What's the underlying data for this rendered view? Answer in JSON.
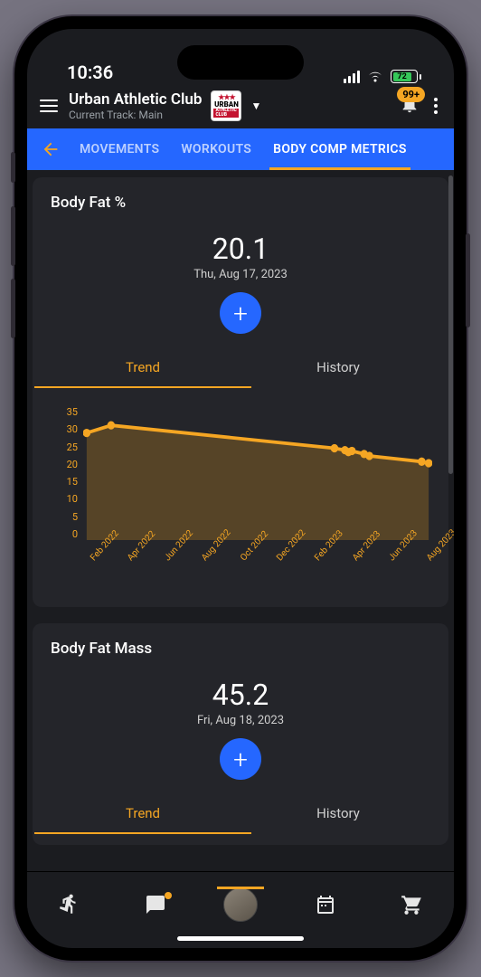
{
  "status": {
    "time": "10:36",
    "battery_pct": "72"
  },
  "header": {
    "club_name": "Urban Athletic Club",
    "subtitle": "Current Track: Main",
    "badge": "99+"
  },
  "segments": {
    "back_icon": "back",
    "items": [
      {
        "label": "MOVEMENTS",
        "active": false
      },
      {
        "label": "WORKOUTS",
        "active": false
      },
      {
        "label": "BODY COMP METRICS",
        "active": true
      }
    ]
  },
  "cards": [
    {
      "title": "Body Fat %",
      "value": "20.1",
      "date": "Thu, Aug 17, 2023",
      "tabs": {
        "trend": "Trend",
        "history": "History",
        "active": "trend"
      }
    },
    {
      "title": "Body Fat Mass",
      "value": "45.2",
      "date": "Fri, Aug 18, 2023",
      "tabs": {
        "trend": "Trend",
        "history": "History",
        "active": "trend"
      }
    }
  ],
  "chart_data": {
    "type": "area",
    "title": "Body Fat % Trend",
    "xlabel": "",
    "ylabel": "",
    "ylim": [
      0,
      35
    ],
    "y_ticks": [
      35,
      30,
      25,
      20,
      15,
      10,
      5,
      0
    ],
    "categories": [
      "Feb 2022",
      "Apr 2022",
      "Jun 2022",
      "Aug 2022",
      "Oct 2022",
      "Dec 2022",
      "Feb 2023",
      "Apr 2023",
      "Jun 2023",
      "Aug 2023"
    ],
    "series": [
      {
        "name": "Body Fat %",
        "x": [
          "Feb 2022",
          "Apr 2022",
          "Apr 2023",
          "May 2023",
          "May 2023",
          "May 2023",
          "Jun 2023",
          "Jun 2023",
          "Aug 2023",
          "Aug 2023"
        ],
        "values": [
          28,
          30,
          24,
          23.5,
          23,
          23.3,
          22.5,
          22,
          20.5,
          20.1
        ]
      }
    ]
  },
  "bottom_nav": {
    "items": [
      "activity",
      "chat",
      "profile",
      "calendar",
      "shop"
    ],
    "active": "profile",
    "chat_has_dot": true
  }
}
